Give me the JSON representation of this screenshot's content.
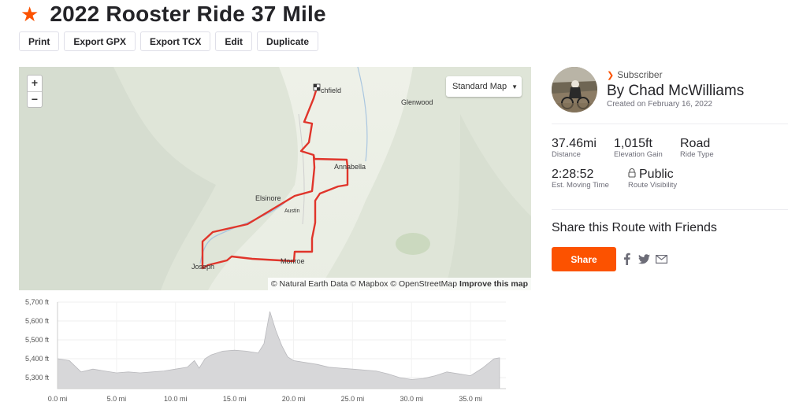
{
  "route": {
    "title": "2022 Rooster Ride 37 Mile",
    "star_icon": "star-icon"
  },
  "toolbar": {
    "print": "Print",
    "export_gpx": "Export GPX",
    "export_tcx": "Export TCX",
    "edit": "Edit",
    "duplicate": "Duplicate"
  },
  "map": {
    "zoom_in": "+",
    "zoom_out": "−",
    "map_type": "Standard Map",
    "attribution": "© Natural Earth Data © Mapbox © OpenStreetMap",
    "improve": "Improve this map",
    "towns": {
      "richfield": "chfield",
      "glenwood": "Glenwood",
      "annabella": "Annabella",
      "elsinore": "Elsinore",
      "austin": "Austin",
      "monroe": "Monroe",
      "joseph": "Joseph"
    },
    "route_color": "#e0352b"
  },
  "author": {
    "badge": "Subscriber",
    "name": "By Chad McWilliams",
    "created": "Created on February 16, 2022"
  },
  "stats": {
    "distance": {
      "value": "37.46mi",
      "label": "Distance"
    },
    "elevation": {
      "value": "1,015ft",
      "label": "Elevation Gain"
    },
    "ride_type": {
      "value": "Road",
      "label": "Ride Type"
    },
    "moving_time": {
      "value": "2:28:52",
      "label": "Est. Moving Time"
    },
    "visibility": {
      "value": "Public",
      "label": "Route Visibility"
    }
  },
  "share": {
    "title": "Share this Route with Friends",
    "button": "Share"
  },
  "elevation_chart": {
    "y_ticks": [
      "5,700 ft",
      "5,600 ft",
      "5,500 ft",
      "5,400 ft",
      "5,300 ft"
    ],
    "x_ticks": [
      "0.0 mi",
      "5.0 mi",
      "10.0 mi",
      "15.0 mi",
      "20.0 mi",
      "25.0 mi",
      "30.0 mi",
      "35.0 mi"
    ]
  },
  "chart_data": {
    "type": "area",
    "xlabel": "",
    "ylabel": "",
    "xlim": [
      0,
      38
    ],
    "ylim": [
      5250,
      5700
    ],
    "x": [
      0,
      1,
      2,
      3,
      4,
      5,
      6,
      7,
      8,
      9,
      10,
      11,
      11.6,
      12,
      12.5,
      13,
      14,
      15,
      16,
      17,
      17.5,
      18,
      18.5,
      19,
      19.5,
      20,
      21,
      22,
      23,
      24,
      25,
      26,
      27,
      28,
      29,
      30,
      31,
      32,
      33,
      34,
      35,
      36,
      37,
      37.46
    ],
    "y": [
      5400,
      5390,
      5330,
      5345,
      5335,
      5325,
      5330,
      5325,
      5330,
      5335,
      5345,
      5355,
      5390,
      5350,
      5400,
      5420,
      5440,
      5445,
      5440,
      5430,
      5480,
      5650,
      5550,
      5470,
      5410,
      5390,
      5380,
      5370,
      5355,
      5350,
      5345,
      5340,
      5335,
      5320,
      5300,
      5290,
      5295,
      5310,
      5330,
      5320,
      5310,
      5350,
      5400,
      5405
    ]
  }
}
